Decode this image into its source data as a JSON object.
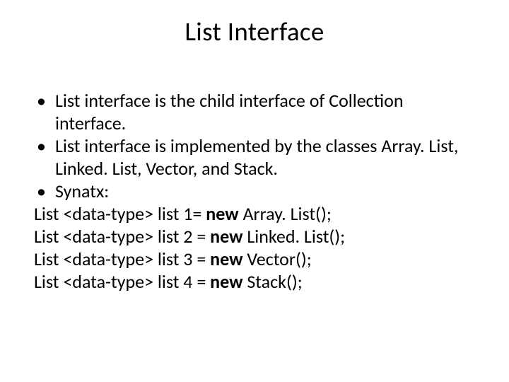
{
  "title": "List Interface",
  "bullets": {
    "b1": "List interface is the child interface of Collection interface.",
    "b2": "List interface is implemented by the classes Array. List, Linked. List, Vector, and Stack.",
    "b3": "Synatx:"
  },
  "lines": {
    "l1a": "List <data-type> list 1= ",
    "l1b": "new ",
    "l1c": "Array. List();",
    "l2a": "List <data-type> list 2 = ",
    "l2b": "new ",
    "l2c": "Linked. List();",
    "l3a": "List <data-type> list 3 = ",
    "l3b": "new ",
    "l3c": "Vector();",
    "l4a": "List <data-type> list 4 = ",
    "l4b": "new ",
    "l4c": "Stack();"
  },
  "dot": "•"
}
